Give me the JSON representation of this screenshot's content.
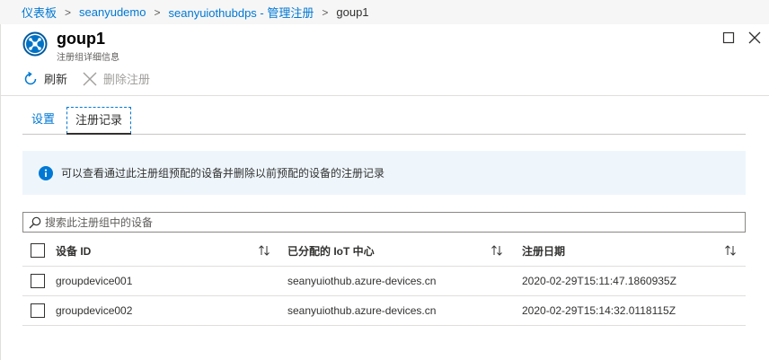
{
  "breadcrumb": {
    "items": [
      "仪表板",
      "seanyudemo",
      "seanyuiothubdps - 管理注册"
    ],
    "current": "goup1",
    "separator": ">"
  },
  "header": {
    "title": "goup1",
    "subtitle": "注册组详细信息",
    "icon": "iot-dps-icon"
  },
  "toolbar": {
    "refresh_label": "刷新",
    "delete_label": "删除注册"
  },
  "tabs": [
    {
      "label": "设置",
      "active": false
    },
    {
      "label": "注册记录",
      "active": true
    }
  ],
  "info": {
    "text": "可以查看通过此注册组预配的设备并删除以前预配的设备的注册记录"
  },
  "search": {
    "placeholder": "搜索此注册组中的设备",
    "value": ""
  },
  "table": {
    "columns": [
      "设备 ID",
      "已分配的 IoT 中心",
      "注册日期"
    ],
    "rows": [
      [
        "groupdevice001",
        "seanyuiothub.azure-devices.cn",
        "2020-02-29T15:11:47.1860935Z"
      ],
      [
        "groupdevice002",
        "seanyuiothub.azure-devices.cn",
        "2020-02-29T15:14:32.0118115Z"
      ]
    ]
  },
  "colors": {
    "accent": "#0078d4",
    "info_bg": "#eef6fc",
    "breadcrumb_bg": "#f6f6f6"
  }
}
